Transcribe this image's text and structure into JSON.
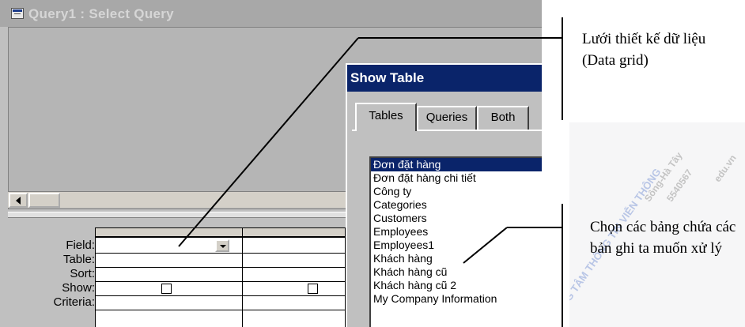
{
  "query_window": {
    "title": "Query1 : Select Query",
    "grid_labels": {
      "field": "Field:",
      "table": "Table:",
      "sort": "Sort:",
      "show": "Show:",
      "criteria": "Criteria:"
    }
  },
  "show_table": {
    "title": "Show Table",
    "tabs": [
      "Tables",
      "Queries",
      "Both"
    ],
    "tables": [
      "Đơn đặt hàng",
      "Đơn đặt hàng chi tiết",
      "Công ty",
      "Categories",
      "Customers",
      "Employees",
      "Employees1",
      "Khách hàng",
      "Khách hàng cũ",
      "Khách hàng cũ 2",
      "My Company Information"
    ],
    "selected_index": 0
  },
  "annotations": {
    "top_caption": "Lưới thiết kế dữ liệu (Data grid)",
    "bottom_caption": "Chọn các bảng chứa các bản ghi ta muốn xử lý"
  },
  "watermark": {
    "lines": [
      "TRUNG TÂM THÔNG TIN VIỄN THÔNG",
      "Sông-Hà Tây",
      "5540567",
      "edu.vn"
    ]
  },
  "colors": {
    "dialog_title_bg": "#0a246a",
    "selection_bg": "#0a246a",
    "window_bg": "#c0c0c0"
  }
}
